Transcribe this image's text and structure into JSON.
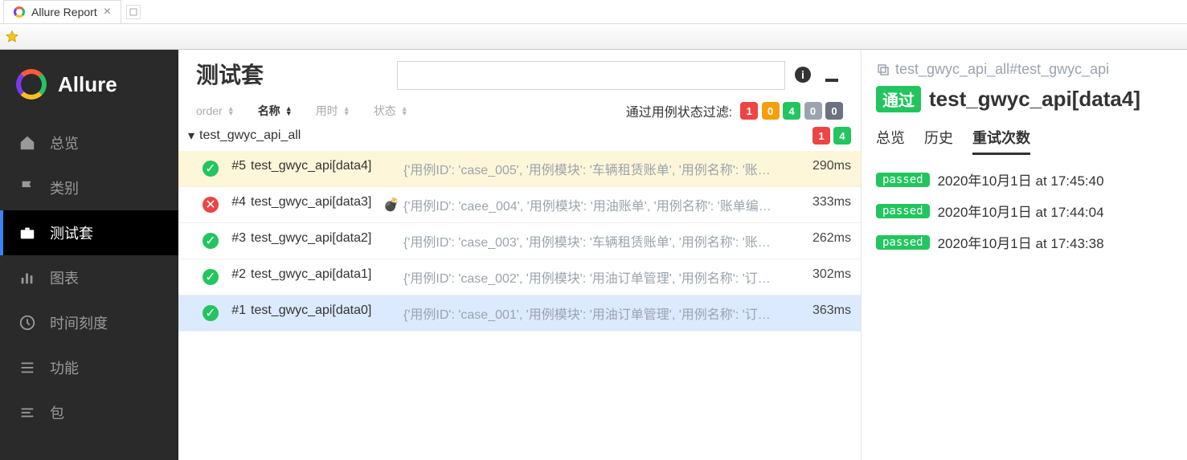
{
  "browser": {
    "tab_title": "Allure Report",
    "new_tab": "+"
  },
  "sidebar": {
    "brand": "Allure",
    "items": [
      {
        "id": "overview",
        "label": "总览"
      },
      {
        "id": "categories",
        "label": "类别"
      },
      {
        "id": "suites",
        "label": "测试套"
      },
      {
        "id": "graph",
        "label": "图表"
      },
      {
        "id": "timeline",
        "label": "时间刻度"
      },
      {
        "id": "behaviors",
        "label": "功能"
      },
      {
        "id": "packages",
        "label": "包"
      }
    ]
  },
  "center": {
    "title": "测试套",
    "search_placeholder": "",
    "columns": {
      "order": "order",
      "name": "名称",
      "duration": "用时",
      "status": "状态"
    },
    "filter_label": "通过用例状态过滤:",
    "filter_badges": [
      {
        "n": "1",
        "color": "#ef4444"
      },
      {
        "n": "0",
        "color": "#f59e0b"
      },
      {
        "n": "4",
        "color": "#22c55e"
      },
      {
        "n": "0",
        "color": "#9ca3af"
      },
      {
        "n": "0",
        "color": "#6b7280"
      }
    ],
    "suite": {
      "name": "test_gwyc_api_all",
      "badges": [
        {
          "n": "1",
          "color": "#ef4444"
        },
        {
          "n": "4",
          "color": "#22c55e"
        }
      ]
    },
    "tests": [
      {
        "num": "#5",
        "name": "test_gwyc_api[data4]",
        "params": "{'用例ID': 'case_005', '用例模块': '车辆租赁账单', '用例名称': '账…",
        "dur": "290ms",
        "status": "pass",
        "flaky": false,
        "selected": true
      },
      {
        "num": "#4",
        "name": "test_gwyc_api[data3]",
        "params": "{'用例ID': 'caee_004', '用例模块': '用油账单', '用例名称': '账单编…",
        "dur": "333ms",
        "status": "fail",
        "flaky": true
      },
      {
        "num": "#3",
        "name": "test_gwyc_api[data2]",
        "params": "{'用例ID': 'case_003', '用例模块': '车辆租赁账单', '用例名称': '账…",
        "dur": "262ms",
        "status": "pass",
        "flaky": false
      },
      {
        "num": "#2",
        "name": "test_gwyc_api[data1]",
        "params": "{'用例ID': 'case_002', '用例模块': '用油订单管理', '用例名称': '订…",
        "dur": "302ms",
        "status": "pass",
        "flaky": false
      },
      {
        "num": "#1",
        "name": "test_gwyc_api[data0]",
        "params": "{'用例ID': 'case_001', '用例模块': '用油订单管理', '用例名称': '订…",
        "dur": "363ms",
        "status": "pass",
        "flaky": false,
        "hovered": true
      }
    ]
  },
  "detail": {
    "crumb": "test_gwyc_api_all#test_gwyc_api",
    "badge": "通过",
    "name": "test_gwyc_api[data4]",
    "tabs": [
      {
        "id": "overview",
        "label": "总览"
      },
      {
        "id": "history",
        "label": "历史"
      },
      {
        "id": "retries",
        "label": "重试次数"
      }
    ],
    "retries": [
      {
        "status": "passed",
        "ts": "2020年10月1日 at 17:45:40"
      },
      {
        "status": "passed",
        "ts": "2020年10月1日 at 17:44:04"
      },
      {
        "status": "passed",
        "ts": "2020年10月1日 at 17:43:38"
      }
    ]
  }
}
